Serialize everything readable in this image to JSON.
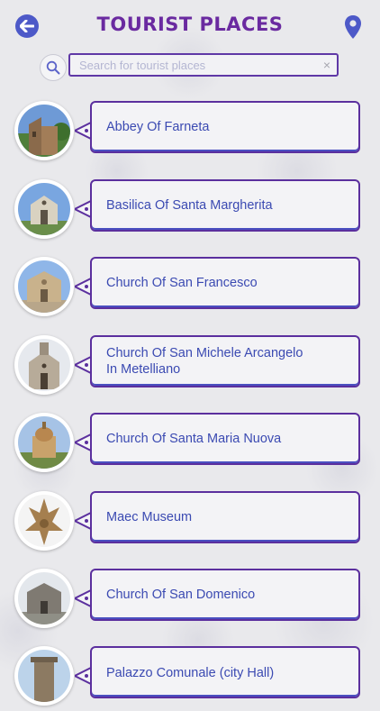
{
  "header": {
    "title": "TOURIST PLACES",
    "back_icon": "back-arrow-icon",
    "map_icon": "map-pin-icon"
  },
  "search": {
    "placeholder": "Search for tourist places",
    "value": "",
    "clear_label": "×"
  },
  "places": [
    {
      "line1": "Abbey Of Farneta",
      "line2": ""
    },
    {
      "line1": "Basilica Of Santa Margherita",
      "line2": ""
    },
    {
      "line1": "Church Of San Francesco",
      "line2": ""
    },
    {
      "line1": "Church Of San Michele Arcangelo",
      "line2": "In Metelliano"
    },
    {
      "line1": "Church Of Santa Maria Nuova",
      "line2": ""
    },
    {
      "line1": "Maec Museum",
      "line2": ""
    },
    {
      "line1": "Church Of San Domenico",
      "line2": ""
    },
    {
      "line1": "Palazzo Comunale (city Hall)",
      "line2": ""
    }
  ],
  "colors": {
    "accent_purple": "#5b2f9e",
    "title_purple": "#6a2aa0",
    "text_blue": "#3b4ab2",
    "icon_blue": "#4d59c8"
  }
}
